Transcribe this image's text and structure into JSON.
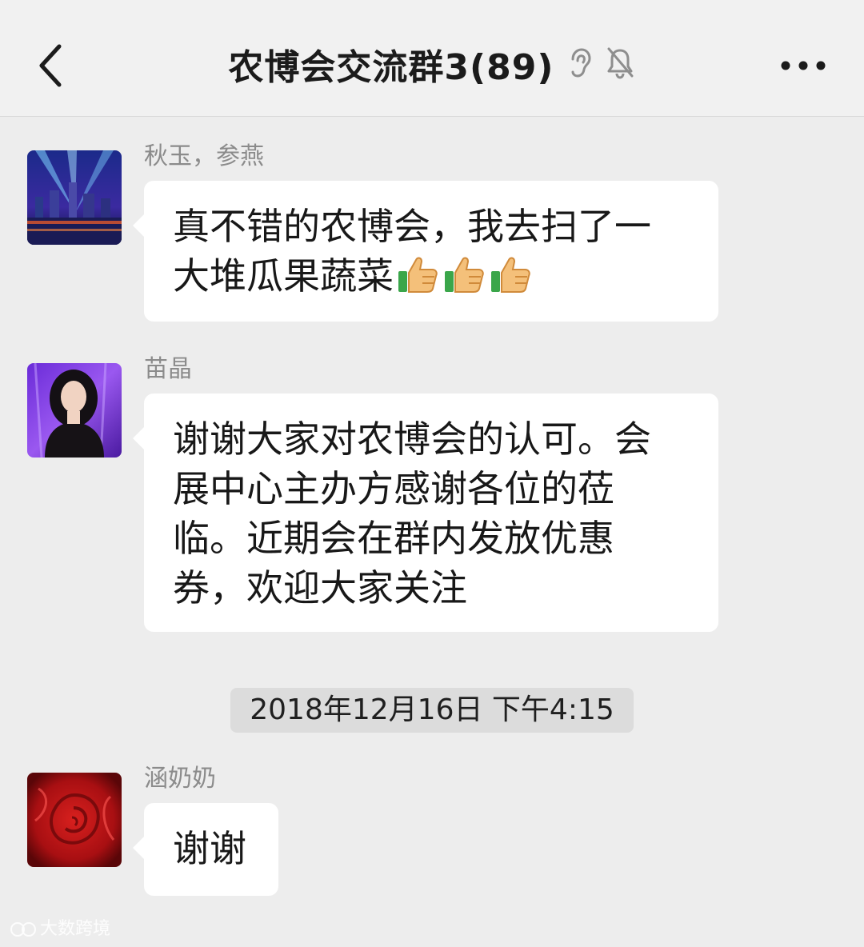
{
  "header": {
    "title": "农博会交流群3(89)",
    "back_icon": "back-chevron-icon",
    "earpiece_icon": "ear-icon",
    "mute_icon": "bell-muted-icon",
    "more_icon": "more-dots-icon"
  },
  "messages": [
    {
      "sender": "秋玉，参燕",
      "lines": [
        "真不错的农博会，我去扫了一",
        "大堆瓜果蔬菜"
      ],
      "emoji": [
        "thumbs-up-icon",
        "thumbs-up-icon",
        "thumbs-up-icon"
      ]
    },
    {
      "sender": "苗晶",
      "lines": [
        "谢谢大家对农博会的认可。会",
        "展中心主办方感谢各位的莅",
        "临。近期会在群内发放优惠",
        "券，欢迎大家关注"
      ]
    },
    {
      "sender": "涵奶奶",
      "lines": [
        "谢谢"
      ]
    }
  ],
  "timestamp": "2018年12月16日 下午4:15",
  "watermark": "大数跨境",
  "colors": {
    "chat_background": "#ededed",
    "header_background": "#f1f1f1",
    "bubble": "#ffffff",
    "timestamp_chip": "#dcdcdc"
  }
}
